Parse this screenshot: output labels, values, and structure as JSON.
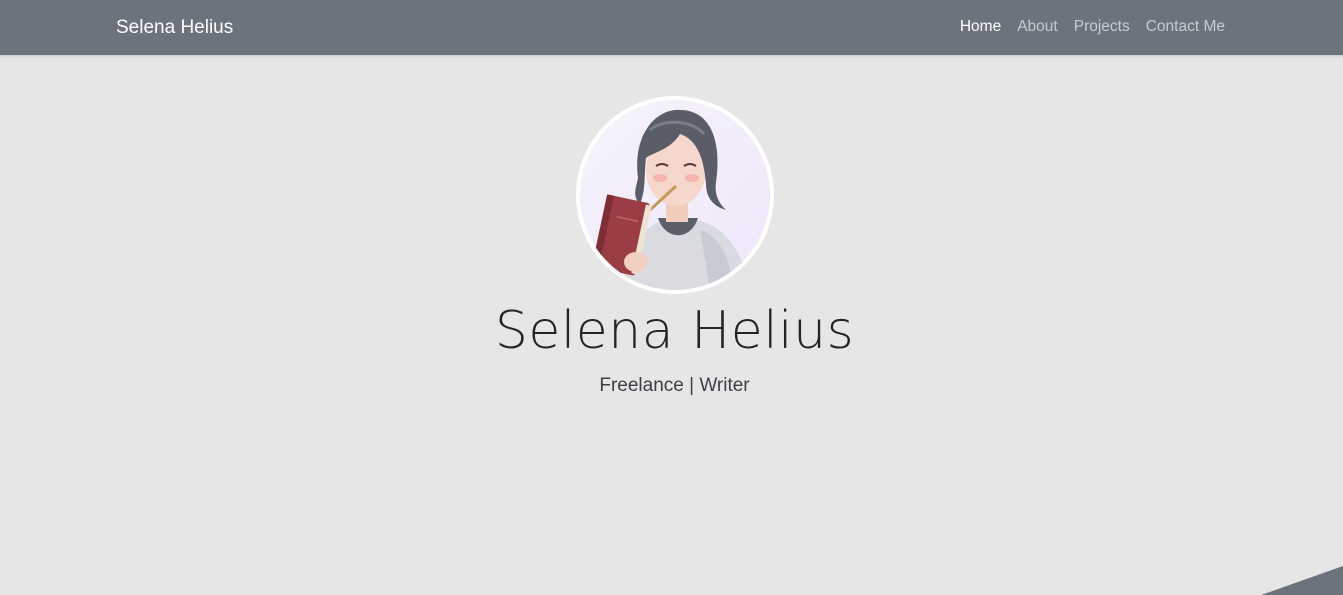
{
  "navbar": {
    "brand": "Selena Helius",
    "links": [
      {
        "label": "Home",
        "active": true
      },
      {
        "label": "About",
        "active": false
      },
      {
        "label": "Projects",
        "active": false
      },
      {
        "label": "Contact Me",
        "active": false
      }
    ]
  },
  "hero": {
    "avatar_icon": "profile-illustration",
    "name": "Selena Helius",
    "tagline": "Freelance | Writer"
  },
  "colors": {
    "navbar_bg": "#6c737d",
    "page_bg": "#e6e6e6",
    "nav_active": "#ffffff",
    "nav_inactive": "#c8ccd2",
    "accent_shape": "#6c737d"
  }
}
